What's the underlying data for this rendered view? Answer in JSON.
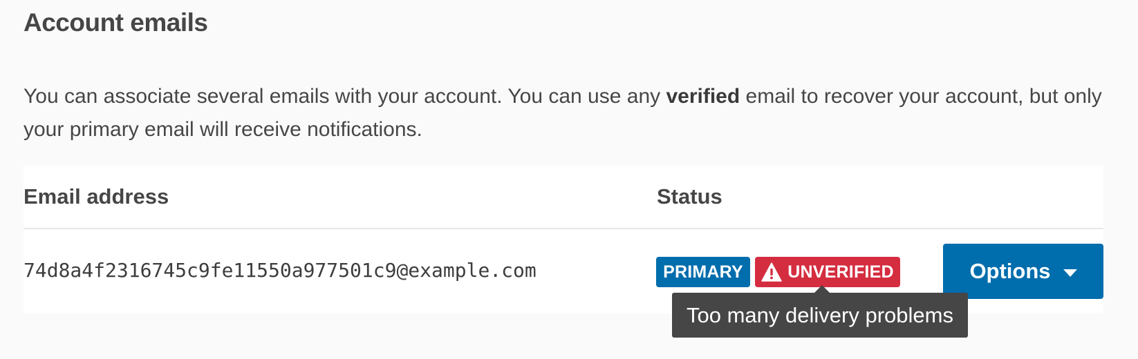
{
  "section": {
    "title": "Account emails",
    "intro_before": "You can associate several emails with your account. You can use any ",
    "intro_bold": "verified",
    "intro_after": " email to recover your account, but only your primary email will receive notifications."
  },
  "table": {
    "columns": [
      "Email address",
      "Status"
    ],
    "rows": [
      {
        "email": "74d8a4f2316745c9fe11550a977501c9@example.com",
        "badges": {
          "primary": "PRIMARY",
          "unverified": "UNVERIFIED"
        },
        "options_label": "Options"
      }
    ]
  },
  "tooltip": {
    "text": "Too many delivery problems"
  },
  "icons": {
    "warning": "warning-triangle-icon",
    "caret": "chevron-down-icon"
  },
  "colors": {
    "primary_blue": "#006dad",
    "danger_red": "#d52d40",
    "tooltip_bg": "#464646"
  }
}
